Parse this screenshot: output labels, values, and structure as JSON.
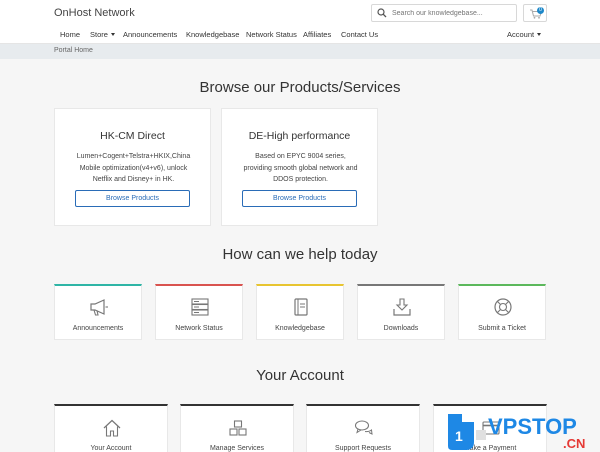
{
  "header": {
    "brand": "OnHost Network",
    "search_placeholder": "Search our knowledgebase...",
    "cart_count": "0"
  },
  "nav": {
    "home": "Home",
    "store": "Store",
    "announcements": "Announcements",
    "knowledgebase": "Knowledgebase",
    "network_status": "Network Status",
    "affiliates": "Affiliates",
    "contact_us": "Contact Us",
    "account": "Account"
  },
  "breadcrumb": "Portal Home",
  "products": {
    "heading": "Browse our Products/Services",
    "items": [
      {
        "title": "HK-CM Direct",
        "desc": "Lumen+Cogent+Telstra+HKIX,China Mobile optimization(v4+v6), unlock Netflix and Disney+ in HK.",
        "button": "Browse Products"
      },
      {
        "title": "DE-High performance",
        "desc": "Based on EPYC 9004 series, providing smooth global network and DDOS protection.",
        "button": "Browse Products"
      }
    ]
  },
  "help": {
    "heading": "How can we help today",
    "tiles": [
      {
        "label": "Announcements",
        "icon": "megaphone-icon",
        "color": "#2fb5a6"
      },
      {
        "label": "Network Status",
        "icon": "server-icon",
        "color": "#d9534f"
      },
      {
        "label": "Knowledgebase",
        "icon": "book-icon",
        "color": "#e8c531"
      },
      {
        "label": "Downloads",
        "icon": "download-icon",
        "color": "#777777"
      },
      {
        "label": "Submit a Ticket",
        "icon": "lifebuoy-icon",
        "color": "#5cb85c"
      }
    ]
  },
  "account": {
    "heading": "Your Account",
    "tiles": [
      {
        "label": "Your Account",
        "icon": "home-icon"
      },
      {
        "label": "Manage Services",
        "icon": "cubes-icon"
      },
      {
        "label": "Support Requests",
        "icon": "comments-icon"
      },
      {
        "label": "Make a Payment",
        "icon": "credit-card-icon"
      }
    ]
  },
  "watermark": {
    "badge": "1",
    "text": "VPSTOP",
    "suffix": ".CN"
  }
}
